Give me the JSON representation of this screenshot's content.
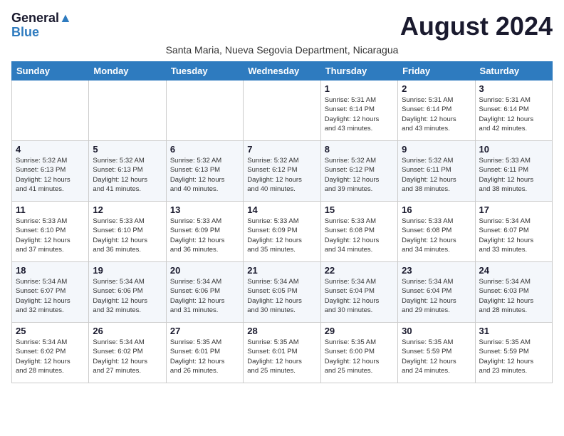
{
  "logo": {
    "line1": "General",
    "line2": "Blue"
  },
  "title": "August 2024",
  "subtitle": "Santa Maria, Nueva Segovia Department, Nicaragua",
  "headers": [
    "Sunday",
    "Monday",
    "Tuesday",
    "Wednesday",
    "Thursday",
    "Friday",
    "Saturday"
  ],
  "weeks": [
    [
      {
        "day": "",
        "info": ""
      },
      {
        "day": "",
        "info": ""
      },
      {
        "day": "",
        "info": ""
      },
      {
        "day": "",
        "info": ""
      },
      {
        "day": "1",
        "info": "Sunrise: 5:31 AM\nSunset: 6:14 PM\nDaylight: 12 hours\nand 43 minutes."
      },
      {
        "day": "2",
        "info": "Sunrise: 5:31 AM\nSunset: 6:14 PM\nDaylight: 12 hours\nand 43 minutes."
      },
      {
        "day": "3",
        "info": "Sunrise: 5:31 AM\nSunset: 6:14 PM\nDaylight: 12 hours\nand 42 minutes."
      }
    ],
    [
      {
        "day": "4",
        "info": "Sunrise: 5:32 AM\nSunset: 6:13 PM\nDaylight: 12 hours\nand 41 minutes."
      },
      {
        "day": "5",
        "info": "Sunrise: 5:32 AM\nSunset: 6:13 PM\nDaylight: 12 hours\nand 41 minutes."
      },
      {
        "day": "6",
        "info": "Sunrise: 5:32 AM\nSunset: 6:13 PM\nDaylight: 12 hours\nand 40 minutes."
      },
      {
        "day": "7",
        "info": "Sunrise: 5:32 AM\nSunset: 6:12 PM\nDaylight: 12 hours\nand 40 minutes."
      },
      {
        "day": "8",
        "info": "Sunrise: 5:32 AM\nSunset: 6:12 PM\nDaylight: 12 hours\nand 39 minutes."
      },
      {
        "day": "9",
        "info": "Sunrise: 5:32 AM\nSunset: 6:11 PM\nDaylight: 12 hours\nand 38 minutes."
      },
      {
        "day": "10",
        "info": "Sunrise: 5:33 AM\nSunset: 6:11 PM\nDaylight: 12 hours\nand 38 minutes."
      }
    ],
    [
      {
        "day": "11",
        "info": "Sunrise: 5:33 AM\nSunset: 6:10 PM\nDaylight: 12 hours\nand 37 minutes."
      },
      {
        "day": "12",
        "info": "Sunrise: 5:33 AM\nSunset: 6:10 PM\nDaylight: 12 hours\nand 36 minutes."
      },
      {
        "day": "13",
        "info": "Sunrise: 5:33 AM\nSunset: 6:09 PM\nDaylight: 12 hours\nand 36 minutes."
      },
      {
        "day": "14",
        "info": "Sunrise: 5:33 AM\nSunset: 6:09 PM\nDaylight: 12 hours\nand 35 minutes."
      },
      {
        "day": "15",
        "info": "Sunrise: 5:33 AM\nSunset: 6:08 PM\nDaylight: 12 hours\nand 34 minutes."
      },
      {
        "day": "16",
        "info": "Sunrise: 5:33 AM\nSunset: 6:08 PM\nDaylight: 12 hours\nand 34 minutes."
      },
      {
        "day": "17",
        "info": "Sunrise: 5:34 AM\nSunset: 6:07 PM\nDaylight: 12 hours\nand 33 minutes."
      }
    ],
    [
      {
        "day": "18",
        "info": "Sunrise: 5:34 AM\nSunset: 6:07 PM\nDaylight: 12 hours\nand 32 minutes."
      },
      {
        "day": "19",
        "info": "Sunrise: 5:34 AM\nSunset: 6:06 PM\nDaylight: 12 hours\nand 32 minutes."
      },
      {
        "day": "20",
        "info": "Sunrise: 5:34 AM\nSunset: 6:06 PM\nDaylight: 12 hours\nand 31 minutes."
      },
      {
        "day": "21",
        "info": "Sunrise: 5:34 AM\nSunset: 6:05 PM\nDaylight: 12 hours\nand 30 minutes."
      },
      {
        "day": "22",
        "info": "Sunrise: 5:34 AM\nSunset: 6:04 PM\nDaylight: 12 hours\nand 30 minutes."
      },
      {
        "day": "23",
        "info": "Sunrise: 5:34 AM\nSunset: 6:04 PM\nDaylight: 12 hours\nand 29 minutes."
      },
      {
        "day": "24",
        "info": "Sunrise: 5:34 AM\nSunset: 6:03 PM\nDaylight: 12 hours\nand 28 minutes."
      }
    ],
    [
      {
        "day": "25",
        "info": "Sunrise: 5:34 AM\nSunset: 6:02 PM\nDaylight: 12 hours\nand 28 minutes."
      },
      {
        "day": "26",
        "info": "Sunrise: 5:34 AM\nSunset: 6:02 PM\nDaylight: 12 hours\nand 27 minutes."
      },
      {
        "day": "27",
        "info": "Sunrise: 5:35 AM\nSunset: 6:01 PM\nDaylight: 12 hours\nand 26 minutes."
      },
      {
        "day": "28",
        "info": "Sunrise: 5:35 AM\nSunset: 6:01 PM\nDaylight: 12 hours\nand 25 minutes."
      },
      {
        "day": "29",
        "info": "Sunrise: 5:35 AM\nSunset: 6:00 PM\nDaylight: 12 hours\nand 25 minutes."
      },
      {
        "day": "30",
        "info": "Sunrise: 5:35 AM\nSunset: 5:59 PM\nDaylight: 12 hours\nand 24 minutes."
      },
      {
        "day": "31",
        "info": "Sunrise: 5:35 AM\nSunset: 5:59 PM\nDaylight: 12 hours\nand 23 minutes."
      }
    ]
  ]
}
